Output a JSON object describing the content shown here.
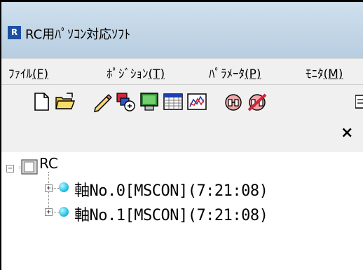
{
  "window": {
    "title": "RC用ﾊﾟｿｺﾝ対応ｿﾌﾄ",
    "icon": "app-icon"
  },
  "menu": [
    {
      "label": "ﾌｧｲﾙ",
      "key": "(F)"
    },
    {
      "label": "ﾎﾟｼﾞｼｮﾝ",
      "key": "(T)"
    },
    {
      "label": "ﾊﾟﾗﾒｰﾀ",
      "key": "(P)"
    },
    {
      "label": "ﾓﾆﾀ",
      "key": "(M)"
    }
  ],
  "toolbar": {
    "icons": [
      "new-file-icon",
      "open-folder-icon",
      "edit-pencil-icon",
      "teaching-icon",
      "monitor-icon",
      "table-icon",
      "graph-icon",
      "connect-icon",
      "disconnect-icon"
    ]
  },
  "panel": {
    "close_glyph": "×"
  },
  "tree": {
    "root": {
      "label": "RC",
      "expander": "−"
    },
    "children": [
      {
        "label": "軸No.0[MSCON](7:21:08)",
        "expander": "+"
      },
      {
        "label": "軸No.1[MSCON](7:21:08)",
        "expander": "+"
      }
    ]
  },
  "colors": {
    "titlebar": "#c4d7e8",
    "status_dot": "#28c4e8",
    "app_icon": "#1d4fa3"
  }
}
